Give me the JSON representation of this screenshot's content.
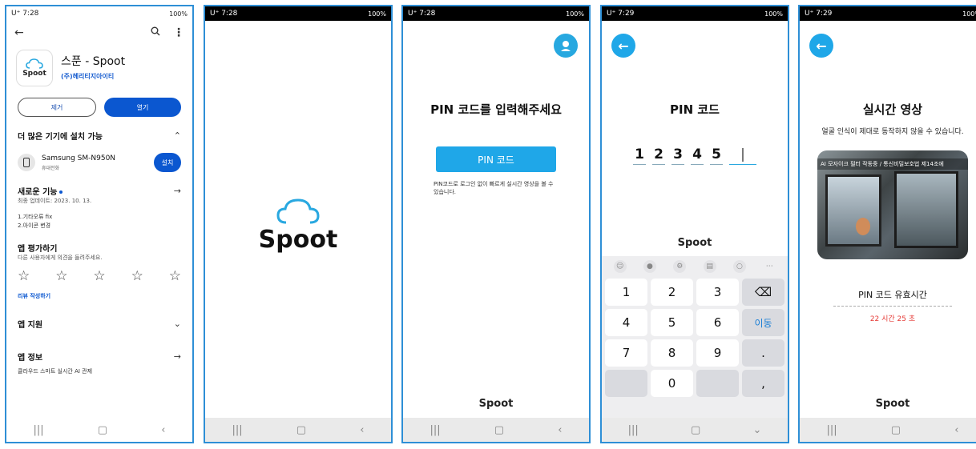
{
  "phone1": {
    "status_time": "U⁺ 7:28",
    "status_right": "100%",
    "app": {
      "name": "스푼 - Spoot",
      "developer": "(주)헤리티지아이티",
      "icon_label": "Spoot"
    },
    "uninstall_label": "제거",
    "open_label": "열기",
    "more_devices": {
      "title": "더 많은 기기에 설치 가능",
      "device_name": "Samsung SM-N950N",
      "device_type": "휴대전화",
      "install_label": "설치"
    },
    "whats_new": {
      "title": "새로운 기능",
      "updated": "최종 업데이트: 2023. 10. 13.",
      "notes": [
        "1.기타오류 fix",
        "2.아이콘 변경"
      ]
    },
    "rate": {
      "title": "앱 평가하기",
      "subtitle": "다른 사용자에게 의견을 들려주세요.",
      "write_review": "리뷰 작성하기"
    },
    "app_support": "앱 지원",
    "app_info": {
      "title": "앱 정보",
      "desc": "클라우드 스마트 실시간 AI 관제"
    }
  },
  "phone2": {
    "status_time": "U⁺ 7:28",
    "status_right": "100%",
    "logo_word": "Spoot"
  },
  "phone3": {
    "status_time": "U⁺ 7:28",
    "status_right": "100%",
    "title": "PIN 코드를 입력해주세요",
    "pin_button": "PIN 코드",
    "desc": "PIN코드로 로그인 없이 빠르게 실시간 영상을 볼 수 있습니다.",
    "brand": "Spoot"
  },
  "phone4": {
    "status_time": "U⁺ 7:29",
    "status_right": "100%",
    "title": "PIN 코드",
    "digits": [
      "1",
      "2",
      "3",
      "4",
      "5",
      "|"
    ],
    "brand": "Spoot",
    "keys": [
      "1",
      "2",
      "3",
      "⌫",
      "4",
      "5",
      "6",
      "이동",
      "7",
      "8",
      "9",
      ".",
      "",
      "0",
      "",
      ","
    ]
  },
  "phone5": {
    "status_time": "U⁺ 7:29",
    "status_right": "100%",
    "title": "실시간 영상",
    "subtitle": "얼굴 인식이 제대로 동작하지 않을 수 있습니다.",
    "video_caption": "AI 모자이크 필터 작동중 / 통신비밀보호법 제14조에",
    "valid_label": "PIN 코드 유효시간",
    "valid_time": "22 시간 25 초",
    "brand": "Spoot"
  },
  "colors": {
    "accent": "#1fa7e8",
    "play_blue": "#0b57d0",
    "timer_red": "#e53935"
  },
  "icons": [
    "back-arrow-icon",
    "search-icon",
    "more-vert-icon",
    "chevron-up-icon",
    "chevron-down-icon",
    "arrow-right-icon",
    "star-outline-icon",
    "cloud-logo-icon",
    "avatar-icon",
    "backspace-icon"
  ]
}
